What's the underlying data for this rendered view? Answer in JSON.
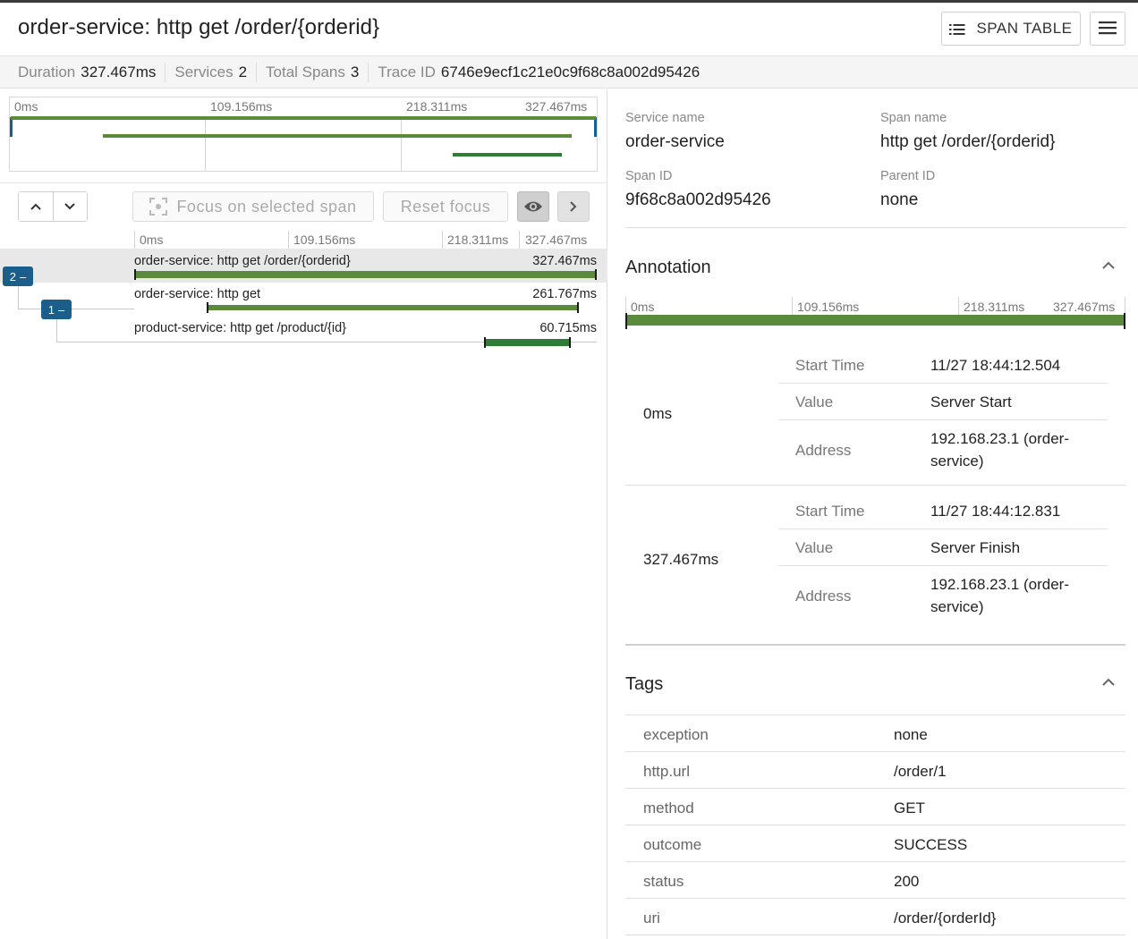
{
  "header": {
    "title": "order-service: http get /order/{orderid}",
    "span_table_label": "SPAN TABLE"
  },
  "summary": {
    "duration_label": "Duration",
    "duration_value": "327.467ms",
    "services_label": "Services",
    "services_value": "2",
    "spans_label": "Total Spans",
    "spans_value": "3",
    "trace_label": "Trace ID",
    "trace_value": "6746e9ecf1c21e0c9f68c8a002d95426"
  },
  "ticks": [
    "0ms",
    "109.156ms",
    "218.311ms",
    "327.467ms"
  ],
  "toolbar": {
    "focus_label": "Focus on selected span",
    "reset_label": "Reset focus"
  },
  "spans": [
    {
      "name": "order-service: http get /order/{orderid}",
      "duration": "327.467ms",
      "badge": "2",
      "start_ms": 0,
      "duration_ms": 327.467
    },
    {
      "name": "order-service: http get",
      "duration": "261.767ms",
      "badge": "1",
      "start_ms": 52.7,
      "duration_ms": 261.767
    },
    {
      "name": "product-service: http get /product/{id}",
      "duration": "60.715ms",
      "badge": "",
      "start_ms": 254.0,
      "duration_ms": 60.715
    }
  ],
  "details": {
    "service_name_label": "Service name",
    "service_name": "order-service",
    "span_name_label": "Span name",
    "span_name": "http get /order/{orderid}",
    "span_id_label": "Span ID",
    "span_id": "9f68c8a002d95426",
    "parent_id_label": "Parent ID",
    "parent_id": "none"
  },
  "annotation": {
    "title": "Annotation",
    "events": [
      {
        "offset": "0ms",
        "start_time_label": "Start Time",
        "start_time": "11/27 18:44:12.504",
        "value_label": "Value",
        "value": "Server Start",
        "address_label": "Address",
        "address_line1": "192.168.23.1 (order-",
        "address_line2": "service)"
      },
      {
        "offset": "327.467ms",
        "start_time_label": "Start Time",
        "start_time": "11/27 18:44:12.831",
        "value_label": "Value",
        "value": "Server Finish",
        "address_label": "Address",
        "address_line1": "192.168.23.1 (order-",
        "address_line2": "service)"
      }
    ]
  },
  "tags": {
    "title": "Tags",
    "items": [
      {
        "key": "exception",
        "value": "none"
      },
      {
        "key": "http.url",
        "value": "/order/1"
      },
      {
        "key": "method",
        "value": "GET"
      },
      {
        "key": "outcome",
        "value": "SUCCESS"
      },
      {
        "key": "status",
        "value": "200"
      },
      {
        "key": "uri",
        "value": "/order/{orderId}"
      }
    ]
  },
  "colors": {
    "span_bar": "#5b8a3a",
    "child_bar": "#2e7d32",
    "badge": "#1b5e8a"
  }
}
